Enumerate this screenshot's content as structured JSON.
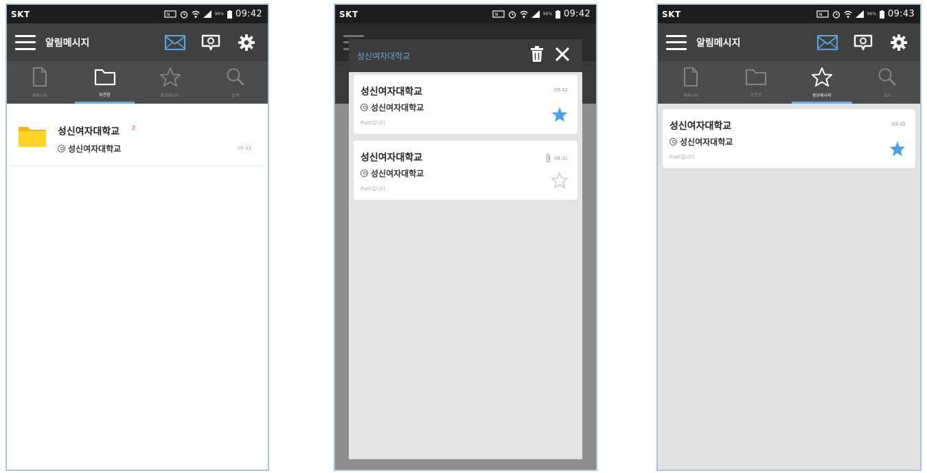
{
  "status_bar": {
    "carrier": "SKT",
    "battery": "96%"
  },
  "screens": [
    {
      "clock": "09:42",
      "app_title": "알림메시지",
      "tabs": [
        {
          "label": "새메시지",
          "icon": "document-icon"
        },
        {
          "label": "보관함",
          "icon": "folder-icon",
          "active": true
        },
        {
          "label": "중요메시지",
          "icon": "star-outline-icon"
        },
        {
          "label": "검색",
          "icon": "magnifier-icon"
        }
      ],
      "folder": {
        "name": "성신여자대학교",
        "count": "2",
        "sender": "성신여자대학교",
        "time": "09:42"
      }
    },
    {
      "clock": "09:42",
      "dialog_title": "성신여자대학교",
      "messages": [
        {
          "title": "성신여자대학교",
          "sender": "성신여자대학교",
          "body": "Push입니다.",
          "time": "09:42",
          "starred": true,
          "attachment": false
        },
        {
          "title": "성신여자대학교",
          "sender": "성신여자대학교",
          "body": "Push입니다.",
          "time": "09:31",
          "starred": false,
          "attachment": true
        }
      ]
    },
    {
      "clock": "09:43",
      "app_title": "알림메시지",
      "tabs": [
        {
          "label": "새메시지",
          "icon": "document-icon"
        },
        {
          "label": "보관함",
          "icon": "folder-icon"
        },
        {
          "label": "중요메시지",
          "icon": "star-outline-icon",
          "active": true
        },
        {
          "label": "검색",
          "icon": "magnifier-icon"
        }
      ],
      "messages": [
        {
          "title": "성신여자대학교",
          "sender": "성신여자대학교",
          "body": "Push입니다.",
          "time": "09:42",
          "starred": true
        }
      ]
    }
  ],
  "colors": {
    "accent": "#5fb1e8",
    "star": "#4aa3e0",
    "appbar": "#404040",
    "tabbar": "#4c4c4c",
    "statusbar": "#1d1d1d"
  }
}
